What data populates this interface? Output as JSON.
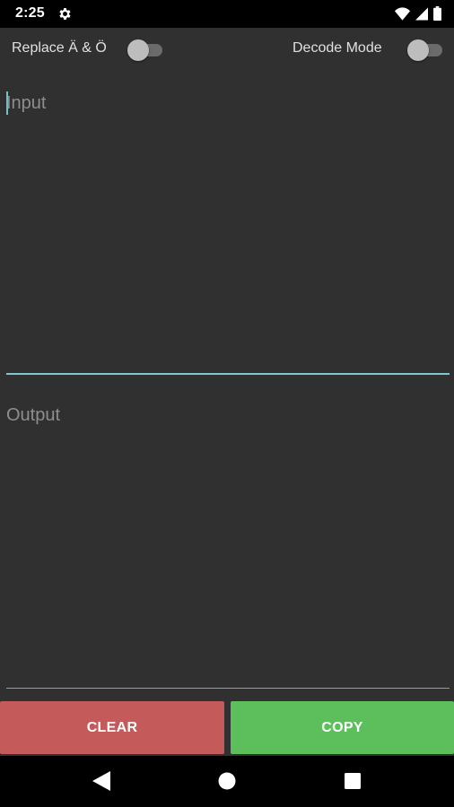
{
  "status_bar": {
    "time": "2:25",
    "icons": [
      "gear-icon",
      "wifi-icon",
      "signal-icon",
      "battery-icon"
    ]
  },
  "switches": {
    "replace": {
      "label": "Replace Ä & Ö",
      "checked": false
    },
    "decode": {
      "label": "Decode Mode",
      "checked": false
    }
  },
  "input": {
    "placeholder": "Input",
    "value": ""
  },
  "output": {
    "placeholder": "Output",
    "value": ""
  },
  "buttons": {
    "clear_label": "CLEAR",
    "copy_label": "COPY"
  },
  "colors": {
    "background": "#303030",
    "accent": "#7ec8c9",
    "clear": "#c45a5a",
    "copy": "#5cbf5c"
  },
  "nav_bar": {
    "icons": [
      "back-icon",
      "home-icon",
      "recents-icon"
    ]
  }
}
